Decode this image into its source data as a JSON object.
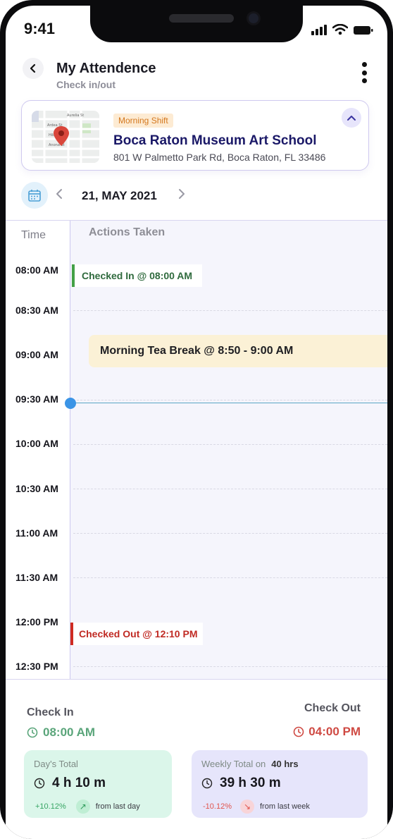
{
  "status_bar": {
    "time": "9:41"
  },
  "header": {
    "title": "My Attendence",
    "subtitle": "Check in/out"
  },
  "location": {
    "shift": "Morning Shift",
    "name": "Boca Raton Museum Art School",
    "address": "801 W Palmetto Park Rd, Boca Raton, FL 33486",
    "map_streets": [
      "Aurelia St",
      "Ardea St",
      "Hibiscus St",
      "Anona St"
    ]
  },
  "date_nav": {
    "date": "21, MAY 2021"
  },
  "timeline": {
    "time_header": "Time",
    "actions_header": "Actions Taken",
    "slots": [
      "08:00  AM",
      "08:30  AM",
      "09:00  AM",
      "09:30  AM",
      "10:00  AM",
      "10:30  AM",
      "11:00  AM",
      "11:30  AM",
      "12:00  PM",
      "12:30  PM"
    ],
    "events": {
      "checked_in": "Checked In @ 08:00 AM",
      "break": "Morning Tea  Break @ 8:50 - 9:00 AM",
      "checked_out": "Checked Out @ 12:10 PM"
    }
  },
  "summary": {
    "check_in_label": "Check In",
    "check_in_time": "08:00 AM",
    "check_out_label": "Check Out",
    "check_out_time": "04:00 PM",
    "day_total": {
      "label": "Day's Total",
      "value": "4 h 10 m",
      "change": "+10.12%",
      "note": "from last day"
    },
    "weekly_total": {
      "label": "Weekly Total on",
      "target": "40 hrs",
      "value": "39 h 30 m",
      "change": "-10.12%",
      "note": "from last week"
    }
  },
  "colors": {
    "accent": "#1a1867",
    "checked_in": "#43a047",
    "checked_out": "#cf2b22",
    "now_indicator": "#3b94e6",
    "break": "#fbf1d6"
  },
  "icons": [
    "back-arrow-icon",
    "more-vertical-icon",
    "map-pin-icon",
    "chevron-up-icon",
    "calendar-icon",
    "chevron-left-icon",
    "chevron-right-icon",
    "clock-icon",
    "trend-up-icon",
    "trend-down-icon"
  ]
}
